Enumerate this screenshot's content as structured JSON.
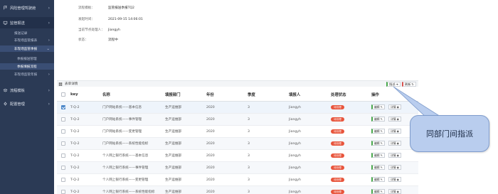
{
  "sidebar": {
    "items": [
      {
        "label": "风险管理驾驶舱",
        "icon": "flag-icon"
      },
      {
        "label": "监管报送",
        "icon": "monitor-icon"
      },
      {
        "label": "流程模板",
        "icon": "layers-icon"
      },
      {
        "label": "配置管理",
        "icon": "gear-icon"
      }
    ],
    "subitems": [
      {
        "label": "报送记录"
      },
      {
        "label": "非现场监管报表"
      },
      {
        "label": "非现场监管季报"
      },
      {
        "label": "季报报送管理"
      },
      {
        "label": "季报填报流程"
      },
      {
        "label": "非现场监管年报"
      }
    ]
  },
  "detail": {
    "fields": [
      {
        "label": "流程模板：",
        "value": "监管报送季报TQ2"
      },
      {
        "label": "发起时间：",
        "value": "2021-09-15 14:06:01"
      },
      {
        "label": "当前节点处理人：",
        "value": "Jiangyh"
      },
      {
        "label": "状态：",
        "value": "流程中"
      }
    ]
  },
  "section": {
    "title": "表单详情",
    "btn_assign": "指派",
    "btn_refresh": "刷新"
  },
  "table": {
    "columns": [
      "key",
      "名称",
      "填报部门",
      "年份",
      "季度",
      "填报人",
      "处理状态",
      "操作"
    ],
    "rows": [
      {
        "key": "T-Q-2",
        "name": "门户网站系统——基本信息",
        "dept": "生产运维部",
        "year": "2020",
        "quarter": "3",
        "user": "Jiangyh",
        "status": "待处理",
        "checked": true
      },
      {
        "key": "T-Q-2",
        "name": "门户网站系统——事件管理",
        "dept": "生产运维部",
        "year": "2020",
        "quarter": "3",
        "user": "Jiangyh",
        "status": "待处理",
        "checked": false
      },
      {
        "key": "T-Q-2",
        "name": "门户网站系统——变更管理",
        "dept": "生产运维部",
        "year": "2020",
        "quarter": "3",
        "user": "Jiangyh",
        "status": "待处理",
        "checked": false
      },
      {
        "key": "T-Q-2",
        "name": "门户网站系统——系统性能指标",
        "dept": "生产运维部",
        "year": "2020",
        "quarter": "3",
        "user": "Jiangyh",
        "status": "待处理",
        "checked": false
      },
      {
        "key": "T-Q-2",
        "name": "个人网上银行系统——基本信息",
        "dept": "生产运维部",
        "year": "2020",
        "quarter": "3",
        "user": "Jiangyh",
        "status": "待处理",
        "checked": false
      },
      {
        "key": "T-Q-2",
        "name": "个人网上银行系统——事件管理",
        "dept": "生产运维部",
        "year": "2020",
        "quarter": "3",
        "user": "Jiangyh",
        "status": "待处理",
        "checked": false
      },
      {
        "key": "T-Q-2",
        "name": "个人网上银行系统——变更管理",
        "dept": "生产运维部",
        "year": "2020",
        "quarter": "3",
        "user": "Jiangyh",
        "status": "待处理",
        "checked": false
      },
      {
        "key": "T-Q-2",
        "name": "个人网上银行系统——系统性能指标",
        "dept": "生产运维部",
        "year": "2020",
        "quarter": "3",
        "user": "Jiangyh",
        "status": "待处理",
        "checked": false
      }
    ],
    "action_edit": "编辑",
    "action_detail": "详情"
  },
  "callout": {
    "text": "同部门间指派"
  },
  "colors": {
    "sidebar": "#2b3a55",
    "badge": "#e8553c",
    "callout": "#b9cdee",
    "accent_green": "#49a84c"
  }
}
